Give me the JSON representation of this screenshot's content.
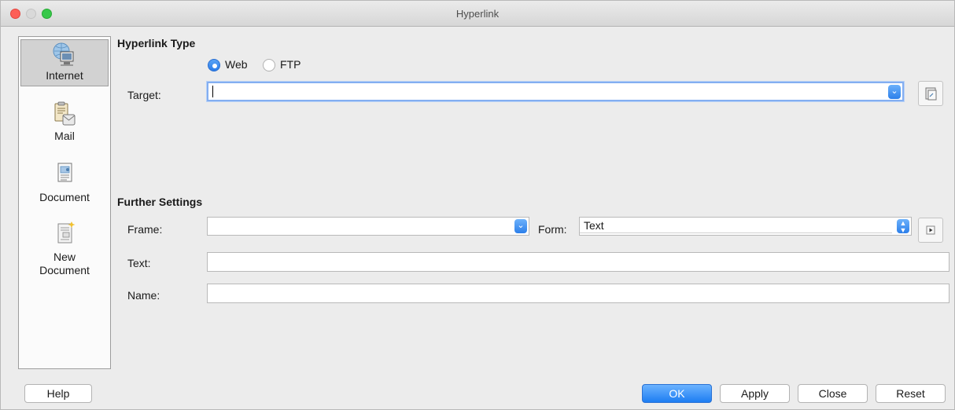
{
  "window": {
    "title": "Hyperlink"
  },
  "sidebar": {
    "items": [
      {
        "label": "Internet",
        "icon": "internet-icon",
        "selected": true
      },
      {
        "label": "Mail",
        "icon": "mail-icon",
        "selected": false
      },
      {
        "label": "Document",
        "icon": "document-icon",
        "selected": false
      },
      {
        "label": "New Document",
        "icon": "new-document-icon",
        "selected": false
      }
    ]
  },
  "hyperlink_type": {
    "title": "Hyperlink Type",
    "options": [
      {
        "label": "Web",
        "selected": true
      },
      {
        "label": "FTP",
        "selected": false
      }
    ],
    "target_label": "Target:",
    "target_value": ""
  },
  "further_settings": {
    "title": "Further Settings",
    "frame_label": "Frame:",
    "frame_value": "",
    "form_label": "Form:",
    "form_value": "Text",
    "text_label": "Text:",
    "text_value": "",
    "name_label": "Name:",
    "name_value": ""
  },
  "buttons": {
    "help": "Help",
    "ok": "OK",
    "apply": "Apply",
    "close": "Close",
    "reset": "Reset"
  },
  "colors": {
    "accent": "#2b7de9",
    "window_bg": "#ececec",
    "focus_ring": "#83aef1"
  }
}
